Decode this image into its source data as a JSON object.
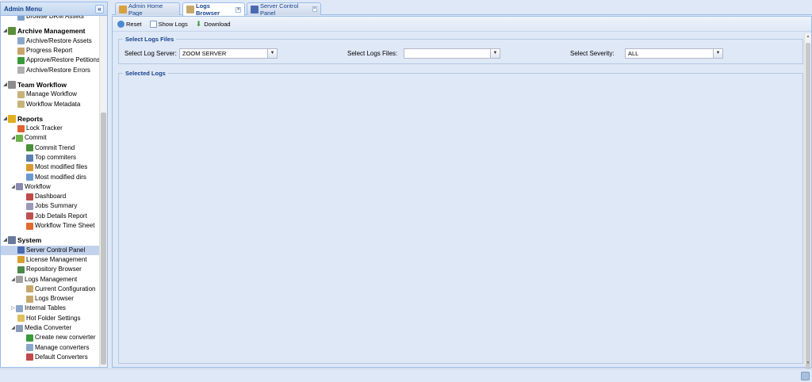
{
  "sidebar": {
    "title": "Admin Menu",
    "collapse_glyph": "«",
    "items": [
      {
        "label": "Browse DRM Assets",
        "level": 2,
        "icon": "drm-assets-icon",
        "color": "#7aa0c8"
      },
      {
        "gap": true
      },
      {
        "label": "Archive Management",
        "level": 0,
        "section": true,
        "arrow": "◢",
        "icon": "archive-icon",
        "color": "#5c8f3a"
      },
      {
        "label": "Archive/Restore Assets",
        "level": 2,
        "icon": "archive-restore-icon",
        "color": "#8aa6c9"
      },
      {
        "label": "Progress Report",
        "level": 2,
        "icon": "progress-report-icon",
        "color": "#c9a36a"
      },
      {
        "label": "Approve/Restore Petitions",
        "level": 2,
        "icon": "approve-petitions-icon",
        "color": "#3a9a3a"
      },
      {
        "label": "Archive/Restore Errors",
        "level": 2,
        "icon": "archive-errors-icon",
        "color": "#b0b0b0"
      },
      {
        "gap": true
      },
      {
        "label": "Team Workflow",
        "level": 0,
        "section": true,
        "arrow": "◢",
        "icon": "team-workflow-icon",
        "color": "#8c8c8c"
      },
      {
        "label": "Manage Workflow",
        "level": 2,
        "icon": "manage-workflow-icon",
        "color": "#c7b27a"
      },
      {
        "label": "Workflow Metadata",
        "level": 2,
        "icon": "workflow-metadata-icon",
        "color": "#c7b27a"
      },
      {
        "gap": true
      },
      {
        "label": "Reports",
        "level": 0,
        "section": true,
        "arrow": "◢",
        "icon": "reports-icon",
        "color": "#e0b020"
      },
      {
        "label": "Lock Tracker",
        "level": 2,
        "icon": "lock-tracker-icon",
        "color": "#e06030"
      },
      {
        "label": "Commit",
        "level": 1,
        "arrow": "◢",
        "icon": "commit-icon",
        "color": "#6bb34a"
      },
      {
        "label": "Commit Trend",
        "level": 3,
        "icon": "commit-trend-icon",
        "color": "#4a8f3a"
      },
      {
        "label": "Top commiters",
        "level": 3,
        "icon": "top-commiters-icon",
        "color": "#5a7fb0"
      },
      {
        "label": "Most modified files",
        "level": 3,
        "icon": "modified-files-icon",
        "color": "#d89a30"
      },
      {
        "label": "Most modified dirs",
        "level": 3,
        "icon": "modified-dirs-icon",
        "color": "#6a9ad0"
      },
      {
        "label": "Workflow",
        "level": 1,
        "arrow": "◢",
        "icon": "workflow-icon",
        "color": "#8a8ab0"
      },
      {
        "label": "Dashboard",
        "level": 3,
        "icon": "dashboard-icon",
        "color": "#c04a4a"
      },
      {
        "label": "Jobs Summary",
        "level": 3,
        "icon": "jobs-summary-icon",
        "color": "#9a9ab8"
      },
      {
        "label": "Job Details Report",
        "level": 3,
        "icon": "job-details-icon",
        "color": "#c05050"
      },
      {
        "label": "Workflow Time Sheet",
        "level": 3,
        "icon": "time-sheet-icon",
        "color": "#e06a30"
      },
      {
        "gap": true
      },
      {
        "label": "System",
        "level": 0,
        "section": true,
        "arrow": "◢",
        "icon": "system-icon",
        "color": "#6a7a9a"
      },
      {
        "label": "Server Control Panel",
        "level": 2,
        "icon": "server-control-icon",
        "color": "#4a6ab0",
        "selected": true
      },
      {
        "label": "License Management",
        "level": 2,
        "icon": "license-icon",
        "color": "#d8a030"
      },
      {
        "label": "Repository Browser",
        "level": 2,
        "icon": "repository-icon",
        "color": "#4a8a4a"
      },
      {
        "label": "Logs Management",
        "level": 1,
        "arrow": "◢",
        "icon": "logs-management-icon",
        "color": "#a0a0a0"
      },
      {
        "label": "Current Configuration",
        "level": 3,
        "icon": "current-config-icon",
        "color": "#c8a86a"
      },
      {
        "label": "Logs Browser",
        "level": 3,
        "icon": "logs-browser-icon",
        "color": "#c8a86a"
      },
      {
        "label": "Internal Tables",
        "level": 1,
        "arrow": "▷",
        "icon": "internal-tables-icon",
        "color": "#8aa6c9"
      },
      {
        "label": "Hot Folder Settings",
        "level": 2,
        "icon": "hot-folder-icon",
        "color": "#e0c060"
      },
      {
        "label": "Media Converter",
        "level": 1,
        "arrow": "◢",
        "icon": "media-converter-icon",
        "color": "#8a9ab8"
      },
      {
        "label": "Create new converter",
        "level": 3,
        "icon": "create-converter-icon",
        "color": "#3a9a3a"
      },
      {
        "label": "Manage converters",
        "level": 3,
        "icon": "manage-converters-icon",
        "color": "#8aa6c9"
      },
      {
        "label": "Default Converters",
        "level": 3,
        "icon": "default-converters-icon",
        "color": "#c04a4a"
      }
    ]
  },
  "tabs": [
    {
      "label": "Admin Home Page",
      "icon": "home-icon",
      "active": false,
      "closable": false
    },
    {
      "label": "Logs Browser",
      "icon": "logs-browser-icon",
      "active": true,
      "closable": true
    },
    {
      "label": "Server Control Panel",
      "icon": "server-control-icon",
      "active": false,
      "closable": true
    }
  ],
  "toolbar": {
    "reset_label": "Reset",
    "show_logs_label": "Show Logs",
    "download_label": "Download"
  },
  "select_files": {
    "legend": "Select Logs Files",
    "log_server_label": "Select Log Server:",
    "log_server_value": "ZOOM SERVER",
    "logs_files_label": "Select Logs Files:",
    "logs_files_value": "",
    "severity_label": "Select Severity:",
    "severity_value": "ALL"
  },
  "selected_logs": {
    "legend": "Selected Logs"
  },
  "colors": {
    "accent": "#15428b",
    "border": "#99bbe8",
    "background": "#dfe8f6"
  }
}
